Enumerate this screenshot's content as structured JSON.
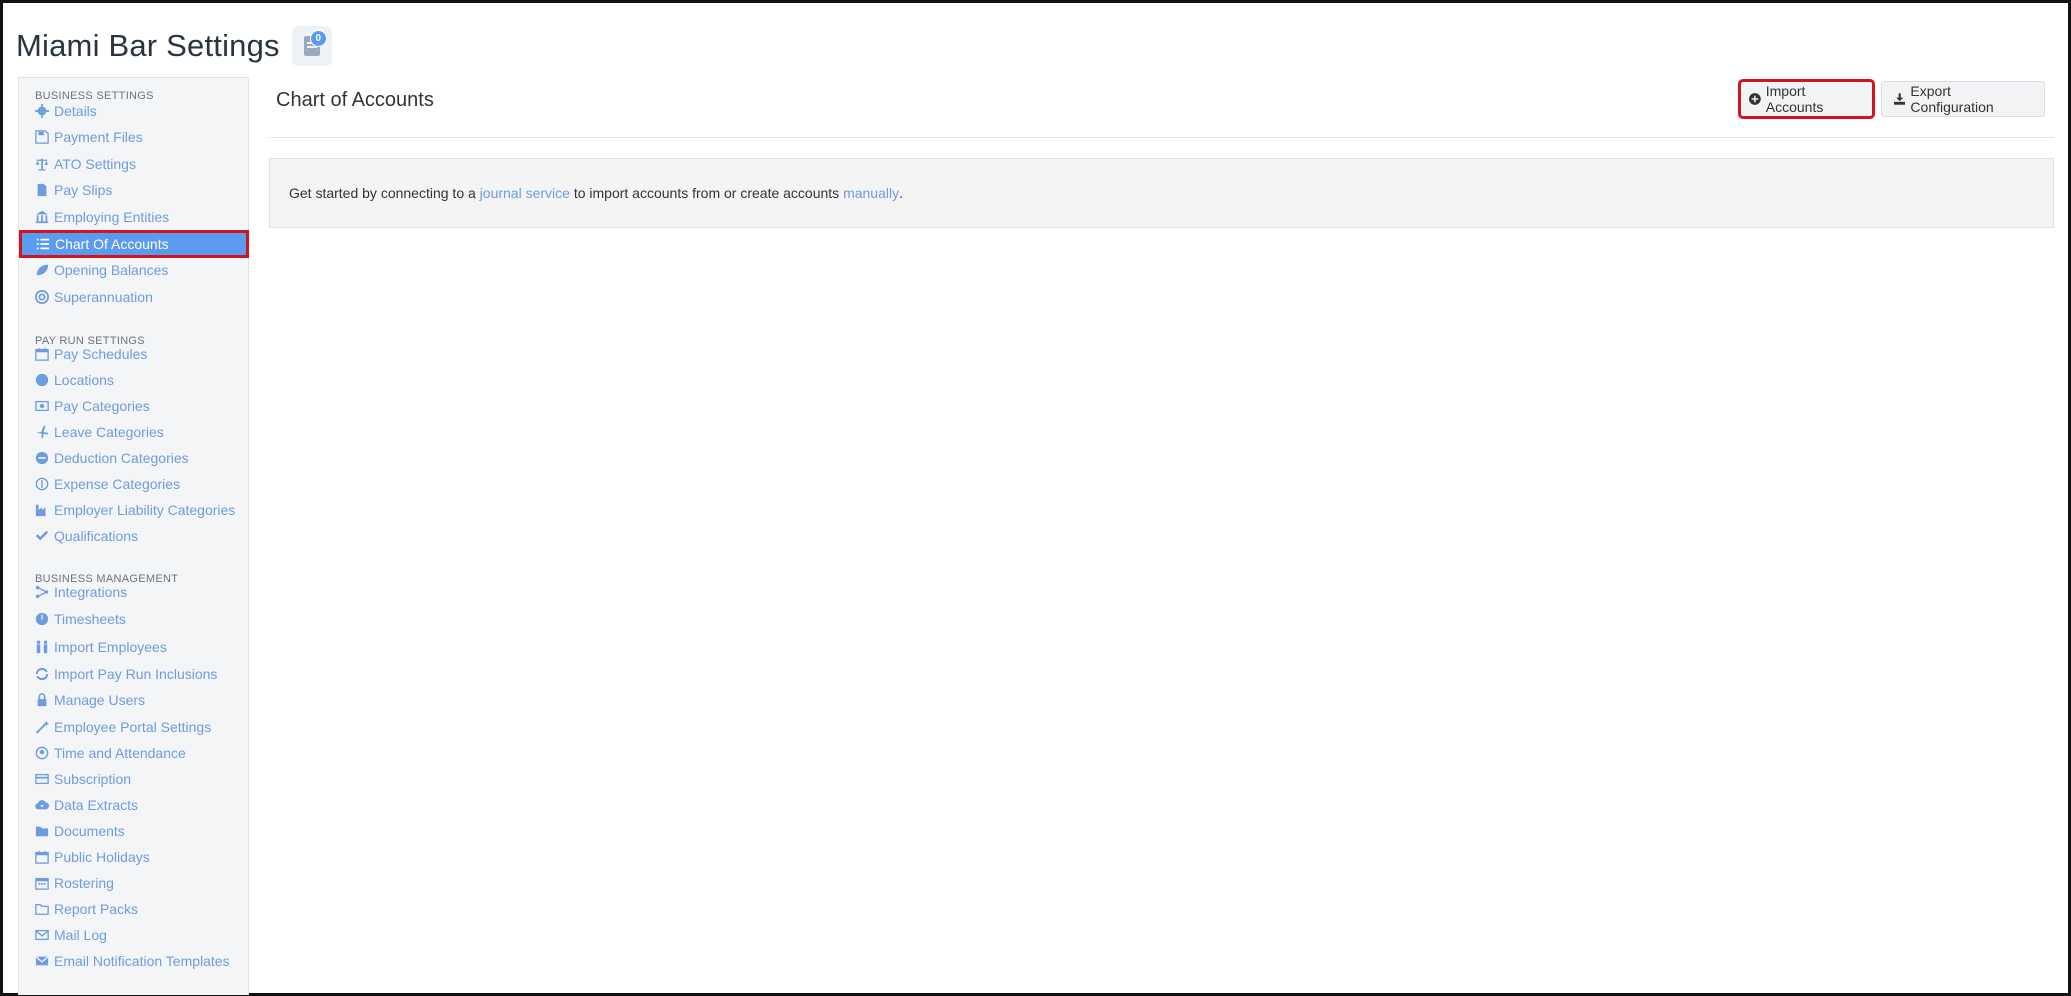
{
  "page": {
    "title": "Miami Bar Settings",
    "notification_count": "0"
  },
  "sidebar": {
    "sections": [
      {
        "title": "BUSINESS SETTINGS"
      },
      {
        "title": "PAY RUN SETTINGS"
      },
      {
        "title": "BUSINESS MANAGEMENT"
      }
    ],
    "items": [
      {
        "label": "Details",
        "icon": "gear-icon"
      },
      {
        "label": "Payment Files",
        "icon": "save-icon"
      },
      {
        "label": "ATO Settings",
        "icon": "scale-icon"
      },
      {
        "label": "Pay Slips",
        "icon": "file-icon"
      },
      {
        "label": "Employing Entities",
        "icon": "bank-icon"
      },
      {
        "label": "Chart Of Accounts",
        "icon": "list-icon"
      },
      {
        "label": "Opening Balances",
        "icon": "leaf-icon"
      },
      {
        "label": "Superannuation",
        "icon": "lifebuoy-icon"
      },
      {
        "label": "Pay Schedules",
        "icon": "calendar-icon"
      },
      {
        "label": "Locations",
        "icon": "globe-icon"
      },
      {
        "label": "Pay Categories",
        "icon": "money-icon"
      },
      {
        "label": "Leave Categories",
        "icon": "plane-icon"
      },
      {
        "label": "Deduction Categories",
        "icon": "minus-circle-icon"
      },
      {
        "label": "Expense Categories",
        "icon": "dollar-circle-icon"
      },
      {
        "label": "Employer Liability Categories",
        "icon": "factory-icon"
      },
      {
        "label": "Qualifications",
        "icon": "check-icon"
      },
      {
        "label": "Integrations",
        "icon": "integration-icon"
      },
      {
        "label": "Timesheets",
        "icon": "clock-icon"
      },
      {
        "label": "Import Employees",
        "icon": "people-icon"
      },
      {
        "label": "Import Pay Run Inclusions",
        "icon": "refresh-icon"
      },
      {
        "label": "Manage Users",
        "icon": "lock-icon"
      },
      {
        "label": "Employee Portal Settings",
        "icon": "magic-wand-icon"
      },
      {
        "label": "Time and Attendance",
        "icon": "user-clock-icon"
      },
      {
        "label": "Subscription",
        "icon": "credit-card-icon"
      },
      {
        "label": "Data Extracts",
        "icon": "cloud-download-icon"
      },
      {
        "label": "Documents",
        "icon": "folder-icon"
      },
      {
        "label": "Public Holidays",
        "icon": "calendar-icon"
      },
      {
        "label": "Rostering",
        "icon": "calendar-grid-icon"
      },
      {
        "label": "Report Packs",
        "icon": "folder-open-icon"
      },
      {
        "label": "Mail Log",
        "icon": "envelope-icon"
      },
      {
        "label": "Email Notification Templates",
        "icon": "envelope-solid-icon"
      }
    ]
  },
  "content": {
    "title": "Chart of Accounts",
    "import_button": "Import Accounts",
    "export_button": "Export Configuration",
    "alert": {
      "prefix": "Get started by connecting to a ",
      "link1": "journal service",
      "middle": " to import accounts from or create accounts ",
      "link2": "manually",
      "suffix": "."
    }
  },
  "colors": {
    "accent": "#5b9bef",
    "link": "#6d9ce0",
    "highlight": "#d3131d"
  }
}
